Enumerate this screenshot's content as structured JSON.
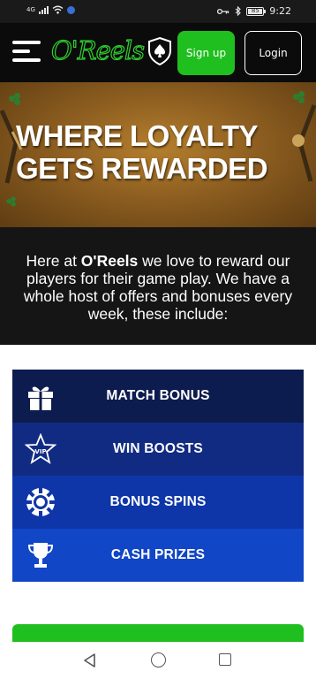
{
  "status_bar": {
    "network": "4G",
    "time": "9:22",
    "battery_level": 0.85,
    "battery_text": "85"
  },
  "header": {
    "logo_text": "O'Reels",
    "signup_label": "Sign up",
    "login_label": "Login"
  },
  "hero": {
    "title": "WHERE LOYALTY GETS REWARDED"
  },
  "intro": {
    "prefix": "Here at ",
    "brand": "O'Reels",
    "suffix": " we love to reward our players for their game play. We have a whole host of offers and bonuses every week, these include:"
  },
  "offers": [
    {
      "label": "MATCH BONUS",
      "icon": "gift-icon",
      "color": "#0c1c4e"
    },
    {
      "label": "WIN BOOSTS",
      "icon": "vip-star-icon",
      "color": "#112b82"
    },
    {
      "label": "BONUS SPINS",
      "icon": "poker-chip-icon",
      "color": "#0f36a8"
    },
    {
      "label": "CASH PRIZES",
      "icon": "trophy-icon",
      "color": "#1146c6"
    }
  ],
  "colors": {
    "brand_green": "#1fbf1f",
    "header_bg": "#0b0b0b",
    "intro_bg": "#151515"
  }
}
